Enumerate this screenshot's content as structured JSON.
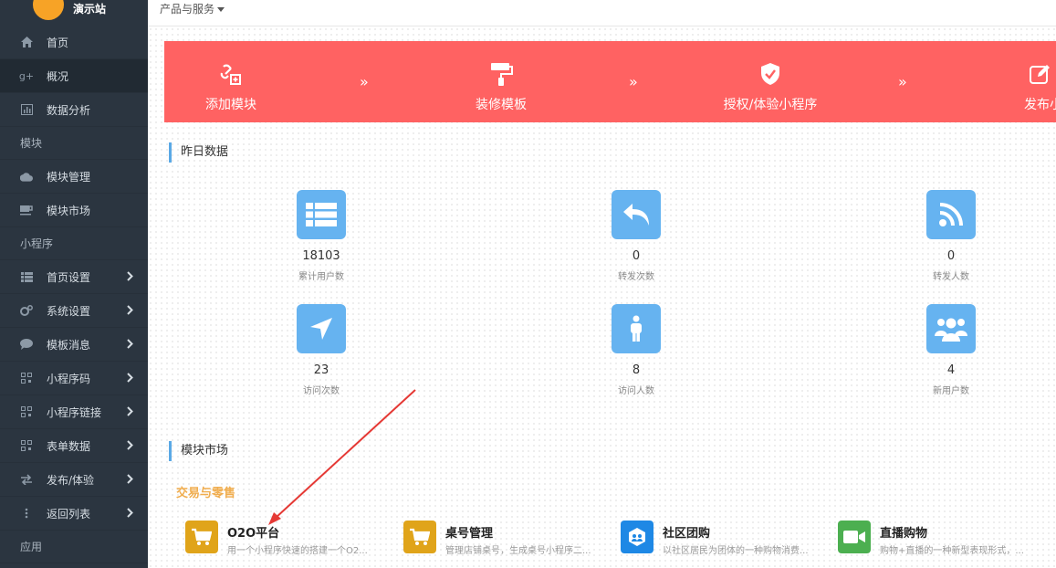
{
  "brand": {
    "name": "演示站"
  },
  "topbar": {
    "menu_label": "产品与服务"
  },
  "sidebar": {
    "items": [
      {
        "label": "首页",
        "icon": "home-icon"
      },
      {
        "label": "概况",
        "icon": "google-plus-icon"
      },
      {
        "label": "数据分析",
        "icon": "bar-chart-icon"
      }
    ],
    "group_modules": "模块",
    "module_items": [
      {
        "label": "模块管理",
        "icon": "cloud-icon"
      },
      {
        "label": "模块市场",
        "icon": "coffee-icon"
      }
    ],
    "group_miniapp": "小程序",
    "miniapp_items": [
      {
        "label": "首页设置",
        "icon": "list-icon"
      },
      {
        "label": "系统设置",
        "icon": "cogs-icon"
      },
      {
        "label": "模板消息",
        "icon": "comment-icon"
      },
      {
        "label": "小程序码",
        "icon": "qrcode-icon"
      },
      {
        "label": "小程序链接",
        "icon": "qrcode-icon"
      },
      {
        "label": "表单数据",
        "icon": "qrcode-icon"
      },
      {
        "label": "发布/体验",
        "icon": "exchange-icon"
      },
      {
        "label": "返回列表",
        "icon": "ellipsis-vertical-icon"
      }
    ],
    "group_app": "应用"
  },
  "steps": [
    {
      "label": "添加模块",
      "icon": "link-plus-icon"
    },
    {
      "label": "装修模板",
      "icon": "paint-roller-icon"
    },
    {
      "label": "授权/体验小程序",
      "icon": "shield-check-icon"
    },
    {
      "label": "发布小程",
      "icon": "edit-icon"
    }
  ],
  "yesterday": {
    "title": "昨日数据",
    "stats": [
      {
        "value": "18103",
        "label": "累计用户数",
        "icon": "table-list-icon"
      },
      {
        "value": "0",
        "label": "转发次数",
        "icon": "reply-icon"
      },
      {
        "value": "0",
        "label": "转发人数",
        "icon": "rss-icon"
      },
      {
        "value": "23",
        "label": "访问次数",
        "icon": "location-arrow-icon"
      },
      {
        "value": "8",
        "label": "访问人数",
        "icon": "male-icon"
      },
      {
        "value": "4",
        "label": "新用户数",
        "icon": "users-icon"
      }
    ]
  },
  "market": {
    "title": "模块市场",
    "category": "交易与零售",
    "modules": [
      {
        "name": "O2O平台",
        "desc": "用一个小程序快速的搭建一个O2...",
        "icon": "cart-icon",
        "color": "#e0a41a"
      },
      {
        "name": "桌号管理",
        "desc": "管理店铺桌号，生成桌号小程序二...",
        "icon": "cart-icon",
        "color": "#e0a41a"
      },
      {
        "name": "社区团购",
        "desc": "以社区居民为团体的一种购物消费...",
        "icon": "community-icon",
        "color": "#1e88e5"
      },
      {
        "name": "直播购物",
        "desc": "购物+直播的一种新型表现形式，...",
        "icon": "video-camera-icon",
        "color": "#4caf50"
      }
    ]
  },
  "colors": {
    "sidebar_bg": "#2b3540",
    "banner": "#ff6262",
    "stat_icon": "#66b3f0",
    "accent": "#f0ad4e"
  }
}
